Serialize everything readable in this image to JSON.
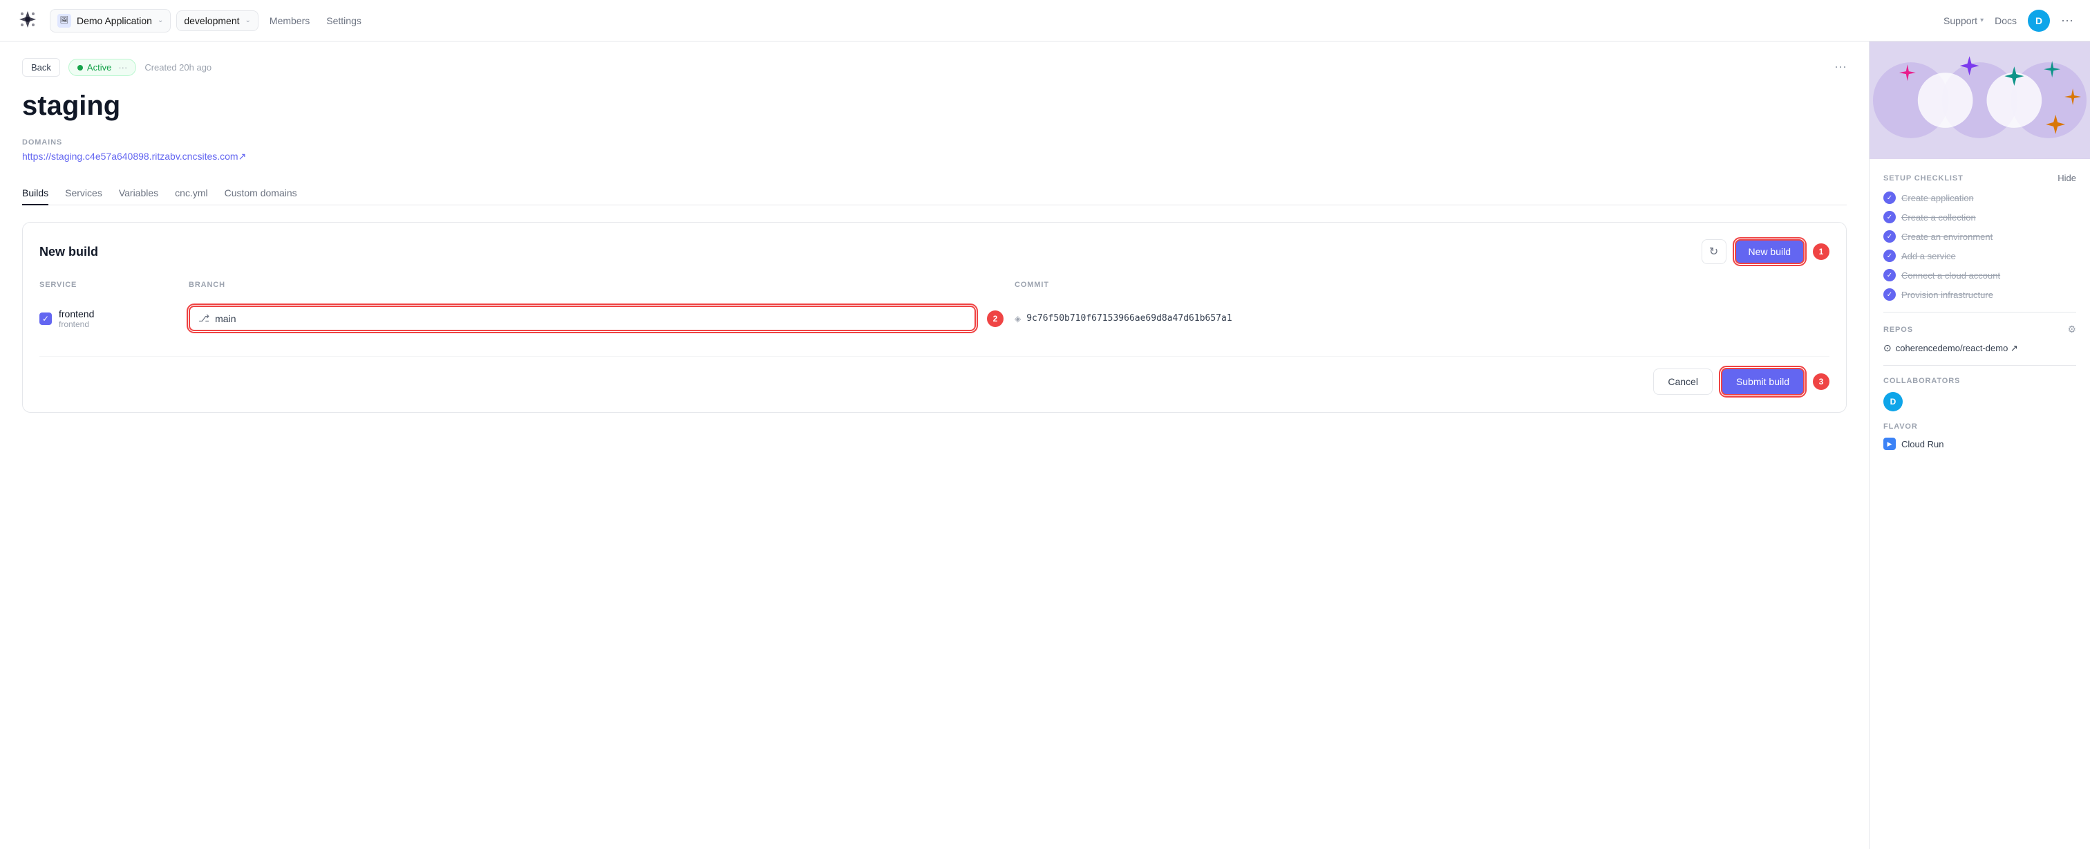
{
  "header": {
    "app_name": "Demo Application",
    "env_name": "development",
    "nav": [
      "Members",
      "Settings"
    ],
    "support_label": "Support",
    "docs_label": "Docs",
    "avatar_initial": "D",
    "more_label": "···"
  },
  "topbar": {
    "back_label": "Back",
    "status_label": "Active",
    "created_label": "Created 20h ago"
  },
  "page": {
    "title": "staging",
    "domains_label": "DOMAINS",
    "domain_url": "https://staging.c4e57a640898.ritzabv.cncsites.com↗"
  },
  "tabs": [
    {
      "label": "Builds",
      "active": true
    },
    {
      "label": "Services",
      "active": false
    },
    {
      "label": "Variables",
      "active": false
    },
    {
      "label": "cnc.yml",
      "active": false
    },
    {
      "label": "Custom domains",
      "active": false
    }
  ],
  "build_section": {
    "title": "New build",
    "new_build_btn": "New build",
    "new_build_step": "1",
    "table": {
      "col_service": "SERVICE",
      "col_branch": "BRANCH",
      "col_commit": "COMMIT",
      "rows": [
        {
          "service_name": "frontend",
          "service_sub": "frontend",
          "branch": "main",
          "commit_hash": "9c76f50b710f67153966ae69d8a47d61b657a1",
          "step": "2"
        }
      ]
    },
    "cancel_btn": "Cancel",
    "submit_btn": "Submit build",
    "submit_step": "3"
  },
  "sidebar": {
    "checklist_title": "SETUP CHECKLIST",
    "hide_label": "Hide",
    "items": [
      {
        "label": "Create application"
      },
      {
        "label": "Create a collection"
      },
      {
        "label": "Create an environment"
      },
      {
        "label": "Add a service"
      },
      {
        "label": "Connect a cloud account"
      },
      {
        "label": "Provision infrastructure"
      }
    ],
    "repos_title": "REPOS",
    "repo_link": "coherencedemo/react-demo ↗",
    "collaborators_title": "COLLABORATORS",
    "collaborator_initial": "D",
    "flavor_title": "FLAVOR",
    "flavor_name": "Cloud Run"
  }
}
